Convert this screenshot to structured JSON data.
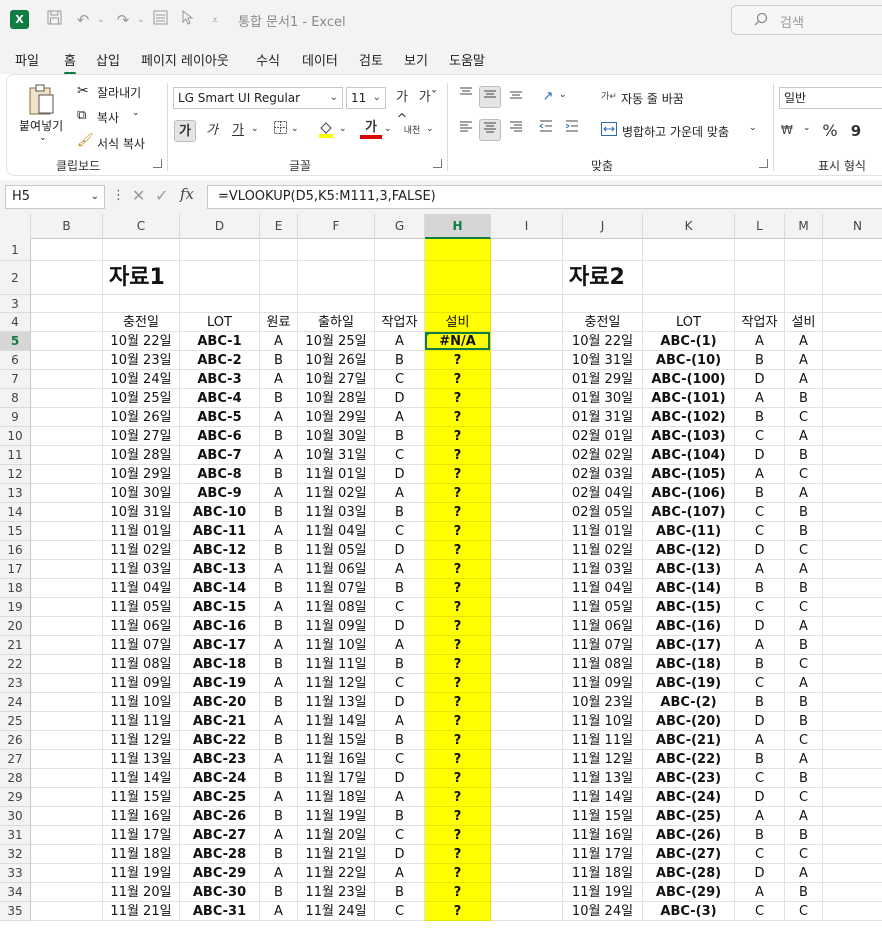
{
  "titlebar": {
    "logo": "X",
    "doc_title": "통합 문서1  -  Excel",
    "search_label": "검색"
  },
  "menu": {
    "tabs": [
      "파일",
      "홈",
      "삽입",
      "페이지 레이아웃",
      "수식",
      "데이터",
      "검토",
      "보기",
      "도움말"
    ],
    "active": "홈"
  },
  "ribbon": {
    "clipboard": {
      "paste": "붙여넣기",
      "cut": "잘라내기",
      "copy": "복사",
      "format_painter": "서식 복사",
      "group": "클립보드"
    },
    "font": {
      "name": "LG Smart UI Regular",
      "size": "11",
      "grow": "가^",
      "shrink": "가ˇ",
      "bold": "가",
      "italic": "가",
      "underline": "가",
      "font_color_label": "가",
      "phonetic": "내천",
      "group": "글꼴",
      "fill_color": "#ffff00",
      "text_color": "#e00000"
    },
    "alignment": {
      "wrap_text": "자동 줄 바꿈",
      "merge_center": "병합하고 가운데 맞춤",
      "group": "맞춤"
    },
    "number": {
      "format": "일반",
      "percent": "%",
      "comma": "9",
      "group": "표시 형식"
    }
  },
  "formula_bar": {
    "name_box": "H5",
    "formula": "=VLOOKUP(D5,K5:M111,3,FALSE)"
  },
  "grid": {
    "columns": [
      "B",
      "C",
      "D",
      "E",
      "F",
      "G",
      "H",
      "I",
      "J",
      "K",
      "L",
      "M",
      "N"
    ],
    "selected_column": "H",
    "rows": [
      "1",
      "2",
      "3",
      "4",
      "5",
      "6",
      "7",
      "8",
      "9",
      "10",
      "11",
      "12",
      "13",
      "14",
      "15",
      "16",
      "17",
      "18",
      "19",
      "20",
      "21",
      "22",
      "23",
      "24",
      "25",
      "26",
      "27",
      "28",
      "29",
      "30",
      "31",
      "32",
      "33",
      "34",
      "35"
    ],
    "selected_row": "5",
    "highlight_color": "#ffff00",
    "table1": {
      "title": "자료1",
      "headers": [
        "충전일",
        "LOT",
        "원료",
        "출하일",
        "작업자",
        "설비"
      ],
      "rows": [
        [
          "10월 22일",
          "ABC-1",
          "A",
          "10월 25일",
          "A",
          "#N/A"
        ],
        [
          "10월 23일",
          "ABC-2",
          "B",
          "10월 26일",
          "B",
          "?"
        ],
        [
          "10월 24일",
          "ABC-3",
          "A",
          "10월 27일",
          "C",
          "?"
        ],
        [
          "10월 25일",
          "ABC-4",
          "B",
          "10월 28일",
          "D",
          "?"
        ],
        [
          "10월 26일",
          "ABC-5",
          "A",
          "10월 29일",
          "A",
          "?"
        ],
        [
          "10월 27일",
          "ABC-6",
          "B",
          "10월 30일",
          "B",
          "?"
        ],
        [
          "10월 28일",
          "ABC-7",
          "A",
          "10월 31일",
          "C",
          "?"
        ],
        [
          "10월 29일",
          "ABC-8",
          "B",
          "11월 01일",
          "D",
          "?"
        ],
        [
          "10월 30일",
          "ABC-9",
          "A",
          "11월 02일",
          "A",
          "?"
        ],
        [
          "10월 31일",
          "ABC-10",
          "B",
          "11월 03일",
          "B",
          "?"
        ],
        [
          "11월 01일",
          "ABC-11",
          "A",
          "11월 04일",
          "C",
          "?"
        ],
        [
          "11월 02일",
          "ABC-12",
          "B",
          "11월 05일",
          "D",
          "?"
        ],
        [
          "11월 03일",
          "ABC-13",
          "A",
          "11월 06일",
          "A",
          "?"
        ],
        [
          "11월 04일",
          "ABC-14",
          "B",
          "11월 07일",
          "B",
          "?"
        ],
        [
          "11월 05일",
          "ABC-15",
          "A",
          "11월 08일",
          "C",
          "?"
        ],
        [
          "11월 06일",
          "ABC-16",
          "B",
          "11월 09일",
          "D",
          "?"
        ],
        [
          "11월 07일",
          "ABC-17",
          "A",
          "11월 10일",
          "A",
          "?"
        ],
        [
          "11월 08일",
          "ABC-18",
          "B",
          "11월 11일",
          "B",
          "?"
        ],
        [
          "11월 09일",
          "ABC-19",
          "A",
          "11월 12일",
          "C",
          "?"
        ],
        [
          "11월 10일",
          "ABC-20",
          "B",
          "11월 13일",
          "D",
          "?"
        ],
        [
          "11월 11일",
          "ABC-21",
          "A",
          "11월 14일",
          "A",
          "?"
        ],
        [
          "11월 12일",
          "ABC-22",
          "B",
          "11월 15일",
          "B",
          "?"
        ],
        [
          "11월 13일",
          "ABC-23",
          "A",
          "11월 16일",
          "C",
          "?"
        ],
        [
          "11월 14일",
          "ABC-24",
          "B",
          "11월 17일",
          "D",
          "?"
        ],
        [
          "11월 15일",
          "ABC-25",
          "A",
          "11월 18일",
          "A",
          "?"
        ],
        [
          "11월 16일",
          "ABC-26",
          "B",
          "11월 19일",
          "B",
          "?"
        ],
        [
          "11월 17일",
          "ABC-27",
          "A",
          "11월 20일",
          "C",
          "?"
        ],
        [
          "11월 18일",
          "ABC-28",
          "B",
          "11월 21일",
          "D",
          "?"
        ],
        [
          "11월 19일",
          "ABC-29",
          "A",
          "11월 22일",
          "A",
          "?"
        ],
        [
          "11월 20일",
          "ABC-30",
          "B",
          "11월 23일",
          "B",
          "?"
        ],
        [
          "11월 21일",
          "ABC-31",
          "A",
          "11월 24일",
          "C",
          "?"
        ]
      ]
    },
    "table2": {
      "title": "자료2",
      "headers": [
        "충전일",
        "LOT",
        "작업자",
        "설비"
      ],
      "rows": [
        [
          "10월 22일",
          "ABC-(1)",
          "A",
          "A"
        ],
        [
          "10월 31일",
          "ABC-(10)",
          "B",
          "A"
        ],
        [
          "01월 29일",
          "ABC-(100)",
          "D",
          "A"
        ],
        [
          "01월 30일",
          "ABC-(101)",
          "A",
          "B"
        ],
        [
          "01월 31일",
          "ABC-(102)",
          "B",
          "C"
        ],
        [
          "02월 01일",
          "ABC-(103)",
          "C",
          "A"
        ],
        [
          "02월 02일",
          "ABC-(104)",
          "D",
          "B"
        ],
        [
          "02월 03일",
          "ABC-(105)",
          "A",
          "C"
        ],
        [
          "02월 04일",
          "ABC-(106)",
          "B",
          "A"
        ],
        [
          "02월 05일",
          "ABC-(107)",
          "C",
          "B"
        ],
        [
          "11월 01일",
          "ABC-(11)",
          "C",
          "B"
        ],
        [
          "11월 02일",
          "ABC-(12)",
          "D",
          "C"
        ],
        [
          "11월 03일",
          "ABC-(13)",
          "A",
          "A"
        ],
        [
          "11월 04일",
          "ABC-(14)",
          "B",
          "B"
        ],
        [
          "11월 05일",
          "ABC-(15)",
          "C",
          "C"
        ],
        [
          "11월 06일",
          "ABC-(16)",
          "D",
          "A"
        ],
        [
          "11월 07일",
          "ABC-(17)",
          "A",
          "B"
        ],
        [
          "11월 08일",
          "ABC-(18)",
          "B",
          "C"
        ],
        [
          "11월 09일",
          "ABC-(19)",
          "C",
          "A"
        ],
        [
          "10월 23일",
          "ABC-(2)",
          "B",
          "B"
        ],
        [
          "11월 10일",
          "ABC-(20)",
          "D",
          "B"
        ],
        [
          "11월 11일",
          "ABC-(21)",
          "A",
          "C"
        ],
        [
          "11월 12일",
          "ABC-(22)",
          "B",
          "A"
        ],
        [
          "11월 13일",
          "ABC-(23)",
          "C",
          "B"
        ],
        [
          "11월 14일",
          "ABC-(24)",
          "D",
          "C"
        ],
        [
          "11월 15일",
          "ABC-(25)",
          "A",
          "A"
        ],
        [
          "11월 16일",
          "ABC-(26)",
          "B",
          "B"
        ],
        [
          "11월 17일",
          "ABC-(27)",
          "C",
          "C"
        ],
        [
          "11월 18일",
          "ABC-(28)",
          "D",
          "A"
        ],
        [
          "11월 19일",
          "ABC-(29)",
          "A",
          "B"
        ],
        [
          "10월 24일",
          "ABC-(3)",
          "C",
          "C"
        ]
      ]
    }
  }
}
